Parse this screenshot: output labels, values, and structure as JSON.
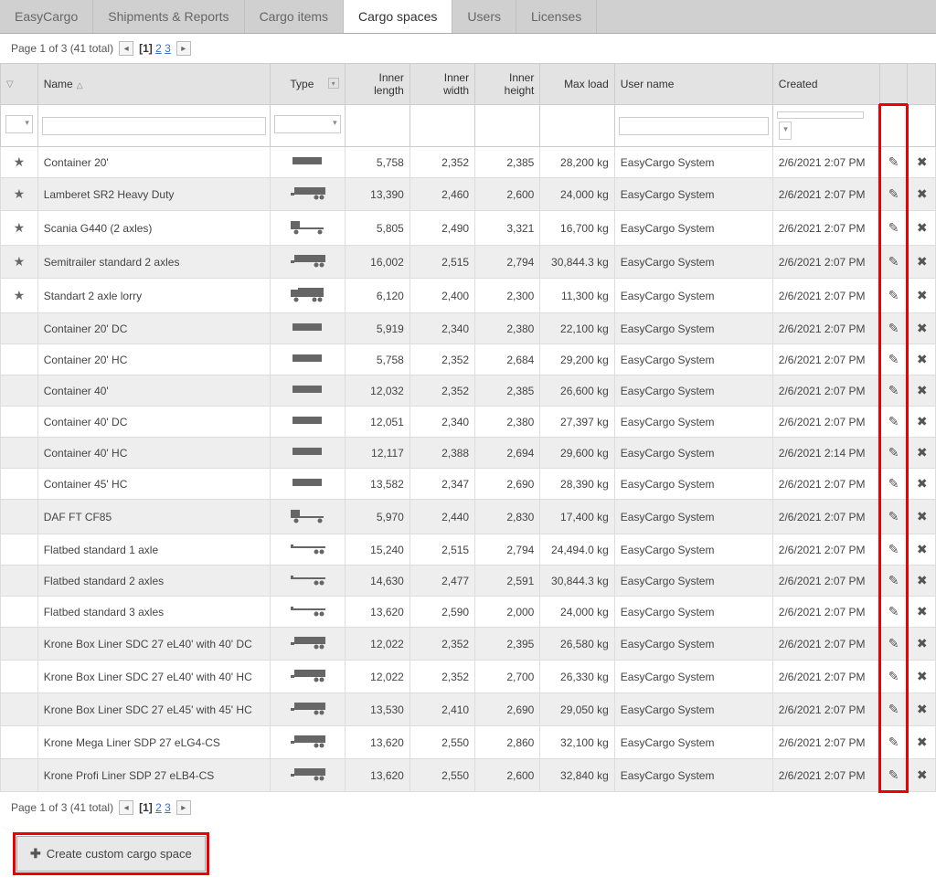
{
  "tabs": [
    "EasyCargo",
    "Shipments & Reports",
    "Cargo items",
    "Cargo spaces",
    "Users",
    "Licenses"
  ],
  "activeTab": 3,
  "pager": {
    "text": "Page 1 of 3 (41 total)",
    "pages": [
      "1",
      "2",
      "3"
    ],
    "current": 0
  },
  "headers": {
    "name": "Name",
    "type": "Type",
    "innerLength": "Inner length",
    "innerWidth": "Inner width",
    "innerHeight": "Inner height",
    "maxLoad": "Max load",
    "userName": "User name",
    "created": "Created"
  },
  "rows": [
    {
      "fav": true,
      "name": "Container 20'",
      "type": "container",
      "len": "5,758",
      "wid": "2,352",
      "hei": "2,385",
      "load": "28,200 kg",
      "user": "EasyCargo System",
      "created": "2/6/2021 2:07 PM"
    },
    {
      "fav": true,
      "name": "Lamberet SR2 Heavy Duty",
      "type": "semitrailer",
      "len": "13,390",
      "wid": "2,460",
      "hei": "2,600",
      "load": "24,000 kg",
      "user": "EasyCargo System",
      "created": "2/6/2021 2:07 PM"
    },
    {
      "fav": true,
      "name": "Scania G440 (2 axles)",
      "type": "truck",
      "len": "5,805",
      "wid": "2,490",
      "hei": "3,321",
      "load": "16,700 kg",
      "user": "EasyCargo System",
      "created": "2/6/2021 2:07 PM"
    },
    {
      "fav": true,
      "name": "Semitrailer standard 2 axles",
      "type": "semitrailer",
      "len": "16,002",
      "wid": "2,515",
      "hei": "2,794",
      "load": "30,844.3 kg",
      "user": "EasyCargo System",
      "created": "2/6/2021 2:07 PM"
    },
    {
      "fav": true,
      "name": "Standart 2 axle lorry",
      "type": "lorry",
      "len": "6,120",
      "wid": "2,400",
      "hei": "2,300",
      "load": "11,300 kg",
      "user": "EasyCargo System",
      "created": "2/6/2021 2:07 PM"
    },
    {
      "fav": false,
      "name": "Container 20' DC",
      "type": "container",
      "len": "5,919",
      "wid": "2,340",
      "hei": "2,380",
      "load": "22,100 kg",
      "user": "EasyCargo System",
      "created": "2/6/2021 2:07 PM"
    },
    {
      "fav": false,
      "name": "Container 20' HC",
      "type": "container",
      "len": "5,758",
      "wid": "2,352",
      "hei": "2,684",
      "load": "29,200 kg",
      "user": "EasyCargo System",
      "created": "2/6/2021 2:07 PM"
    },
    {
      "fav": false,
      "name": "Container 40'",
      "type": "container",
      "len": "12,032",
      "wid": "2,352",
      "hei": "2,385",
      "load": "26,600 kg",
      "user": "EasyCargo System",
      "created": "2/6/2021 2:07 PM"
    },
    {
      "fav": false,
      "name": "Container 40' DC",
      "type": "container",
      "len": "12,051",
      "wid": "2,340",
      "hei": "2,380",
      "load": "27,397 kg",
      "user": "EasyCargo System",
      "created": "2/6/2021 2:07 PM"
    },
    {
      "fav": false,
      "name": "Container 40' HC",
      "type": "container",
      "len": "12,117",
      "wid": "2,388",
      "hei": "2,694",
      "load": "29,600 kg",
      "user": "EasyCargo System",
      "created": "2/6/2021 2:14 PM"
    },
    {
      "fav": false,
      "name": "Container 45' HC",
      "type": "container",
      "len": "13,582",
      "wid": "2,347",
      "hei": "2,690",
      "load": "28,390 kg",
      "user": "EasyCargo System",
      "created": "2/6/2021 2:07 PM"
    },
    {
      "fav": false,
      "name": "DAF FT CF85",
      "type": "truck",
      "len": "5,970",
      "wid": "2,440",
      "hei": "2,830",
      "load": "17,400 kg",
      "user": "EasyCargo System",
      "created": "2/6/2021 2:07 PM"
    },
    {
      "fav": false,
      "name": "Flatbed standard 1 axle",
      "type": "flatbed",
      "len": "15,240",
      "wid": "2,515",
      "hei": "2,794",
      "load": "24,494.0 kg",
      "user": "EasyCargo System",
      "created": "2/6/2021 2:07 PM"
    },
    {
      "fav": false,
      "name": "Flatbed standard 2 axles",
      "type": "flatbed",
      "len": "14,630",
      "wid": "2,477",
      "hei": "2,591",
      "load": "30,844.3 kg",
      "user": "EasyCargo System",
      "created": "2/6/2021 2:07 PM"
    },
    {
      "fav": false,
      "name": "Flatbed standard 3 axles",
      "type": "flatbed",
      "len": "13,620",
      "wid": "2,590",
      "hei": "2,000",
      "load": "24,000 kg",
      "user": "EasyCargo System",
      "created": "2/6/2021 2:07 PM"
    },
    {
      "fav": false,
      "name": "Krone Box Liner SDC 27 eL40' with 40' DC",
      "type": "semitrailer",
      "len": "12,022",
      "wid": "2,352",
      "hei": "2,395",
      "load": "26,580 kg",
      "user": "EasyCargo System",
      "created": "2/6/2021 2:07 PM"
    },
    {
      "fav": false,
      "name": "Krone Box Liner SDC 27 eL40' with 40' HC",
      "type": "semitrailer",
      "len": "12,022",
      "wid": "2,352",
      "hei": "2,700",
      "load": "26,330 kg",
      "user": "EasyCargo System",
      "created": "2/6/2021 2:07 PM"
    },
    {
      "fav": false,
      "name": "Krone Box Liner SDC 27 eL45' with 45' HC",
      "type": "semitrailer",
      "len": "13,530",
      "wid": "2,410",
      "hei": "2,690",
      "load": "29,050 kg",
      "user": "EasyCargo System",
      "created": "2/6/2021 2:07 PM"
    },
    {
      "fav": false,
      "name": "Krone Mega Liner SDP 27 eLG4-CS",
      "type": "semitrailer",
      "len": "13,620",
      "wid": "2,550",
      "hei": "2,860",
      "load": "32,100 kg",
      "user": "EasyCargo System",
      "created": "2/6/2021 2:07 PM"
    },
    {
      "fav": false,
      "name": "Krone Profi Liner SDP 27 eLB4-CS",
      "type": "semitrailer",
      "len": "13,620",
      "wid": "2,550",
      "hei": "2,600",
      "load": "32,840 kg",
      "user": "EasyCargo System",
      "created": "2/6/2021 2:07 PM"
    }
  ],
  "createButton": "Create custom cargo space"
}
